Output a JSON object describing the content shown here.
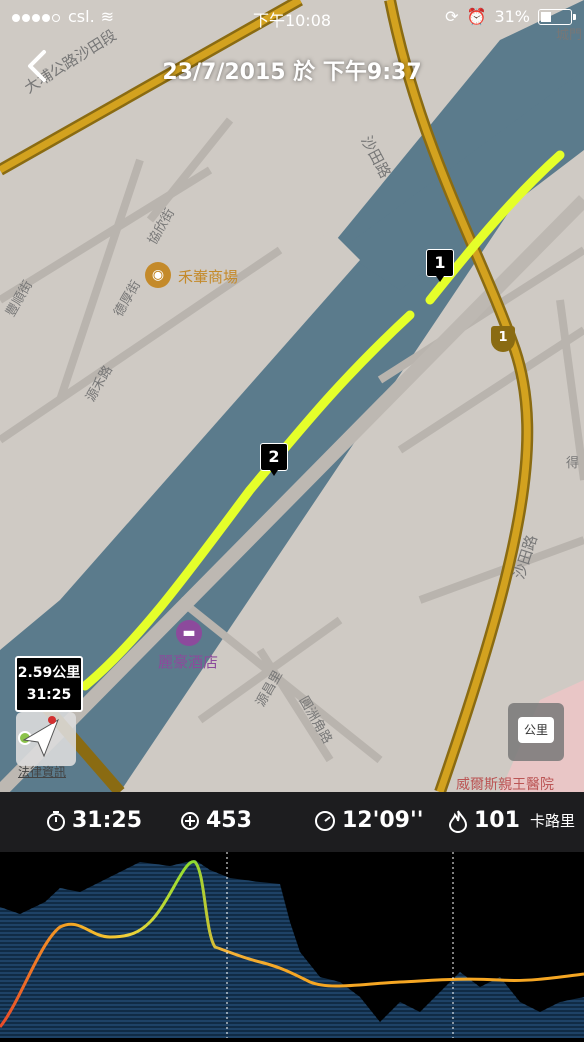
{
  "status_bar": {
    "carrier": "csl.",
    "time": "下午10:08",
    "battery": "31%"
  },
  "nav": {
    "title": "23/7/2015 於 下午9:37"
  },
  "map": {
    "labels": [
      {
        "text": "大埔公路沙田段"
      },
      {
        "text": "沙田路"
      },
      {
        "text": "沙田路"
      },
      {
        "text": "協欣街"
      },
      {
        "text": "禾輋商場"
      },
      {
        "text": "德厚街"
      },
      {
        "text": "源禾路"
      },
      {
        "text": "豐順街"
      },
      {
        "text": "麗豪酒店"
      },
      {
        "text": "源昌里"
      },
      {
        "text": "圓洲角路"
      },
      {
        "text": "威爾斯親王醫院"
      },
      {
        "text": "城門"
      },
      {
        "text": "得"
      }
    ],
    "markers": [
      "1",
      "2"
    ],
    "road_shield": "1",
    "distance_label": "2.59公里",
    "time_label": "31:25",
    "legal_link": "法律資訊",
    "unit_button": "公里"
  },
  "stats": {
    "duration": "31:25",
    "elevation": "453",
    "pace": "12'09''",
    "calories": "101",
    "calories_unit": "卡路里"
  },
  "colors": {
    "route": "#e5ff2a",
    "water": "#5b7b8c",
    "road": "#c99a2e",
    "chart_area": "#1c3a5a"
  }
}
